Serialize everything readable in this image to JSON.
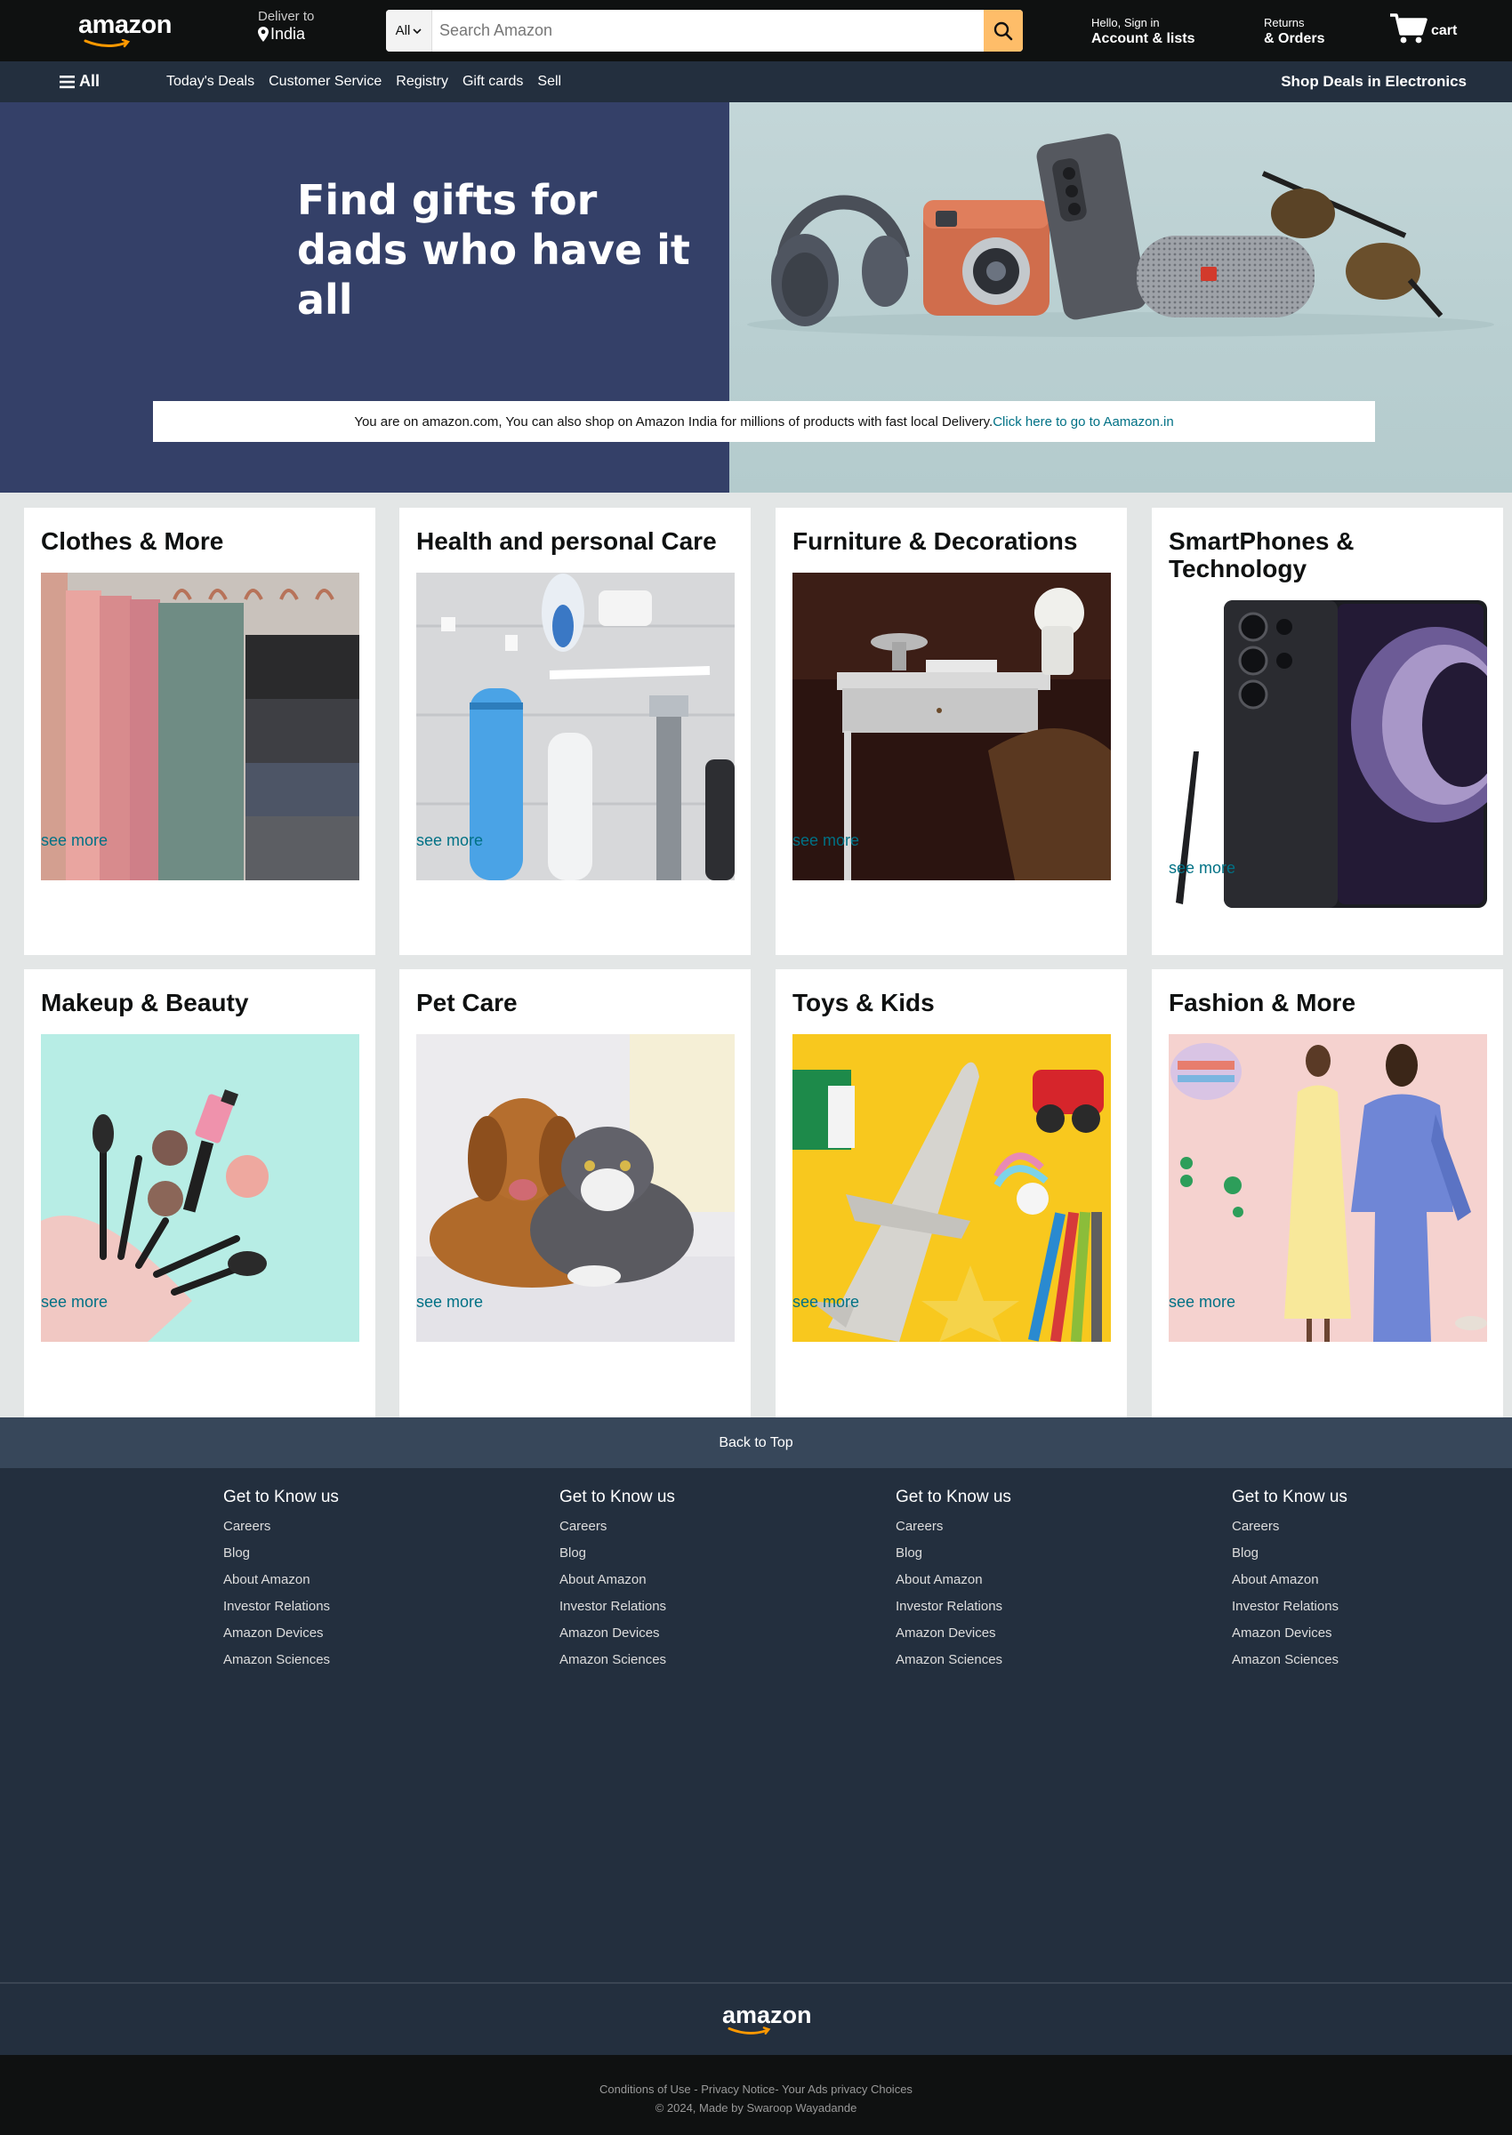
{
  "header": {
    "logo": "amazon",
    "deliver_label": "Deliver to",
    "deliver_location": "India",
    "search_category": "All",
    "search_placeholder": "Search Amazon",
    "account_greeting": "Hello, Sign in",
    "account_label": "Account & lists",
    "returns_label": "Returns",
    "orders_label": "& Orders",
    "cart_label": "cart"
  },
  "nav": {
    "all_label": "All",
    "links": [
      "Today's Deals",
      "Customer Service",
      "Registry",
      "Gift cards",
      "Sell"
    ],
    "promo": "Shop Deals in Electronics"
  },
  "hero": {
    "title_line1": "Find gifts for",
    "title_line2": "dads who have it all",
    "notice_text": "You are on amazon.com, You can also shop on Amazon India for millions of products with fast local Delivery.",
    "notice_link": "Click here to go to Aamazon.in"
  },
  "cards": [
    {
      "title": "Clothes & More",
      "link": "see more"
    },
    {
      "title": "Health and personal Care",
      "link": "see more"
    },
    {
      "title": "Furniture & Decorations",
      "link": "see more"
    },
    {
      "title": "SmartPhones & Technology",
      "link": "see more"
    },
    {
      "title": "Makeup & Beauty",
      "link": "see more"
    },
    {
      "title": "Pet Care",
      "link": "see more"
    },
    {
      "title": "Toys & Kids",
      "link": "see more"
    },
    {
      "title": "Fashion & More",
      "link": "see more"
    }
  ],
  "footer": {
    "back_to_top": "Back to Top",
    "columns": [
      {
        "heading": "Get to Know us",
        "links": [
          "Careers",
          "Blog",
          "About Amazon",
          "Investor Relations",
          "Amazon Devices",
          "Amazon Sciences"
        ]
      },
      {
        "heading": "Get to Know us",
        "links": [
          "Careers",
          "Blog",
          "About Amazon",
          "Investor Relations",
          "Amazon Devices",
          "Amazon Sciences"
        ]
      },
      {
        "heading": "Get to Know us",
        "links": [
          "Careers",
          "Blog",
          "About Amazon",
          "Investor Relations",
          "Amazon Devices",
          "Amazon Sciences"
        ]
      },
      {
        "heading": "Get to Know us",
        "links": [
          "Careers",
          "Blog",
          "About Amazon",
          "Investor Relations",
          "Amazon Devices",
          "Amazon Sciences"
        ]
      }
    ],
    "logo": "amazon",
    "legal": "Conditions of Use - Privacy Notice- Your Ads privacy Choices",
    "copyright": "© 2024, Made by Swaroop Wayadande"
  },
  "colors": {
    "header_bg": "#0f1111",
    "nav_bg": "#232f3e",
    "search_button": "#febd69",
    "link": "#007185",
    "hero_bg": "#344068",
    "smile": "#ff9900"
  }
}
